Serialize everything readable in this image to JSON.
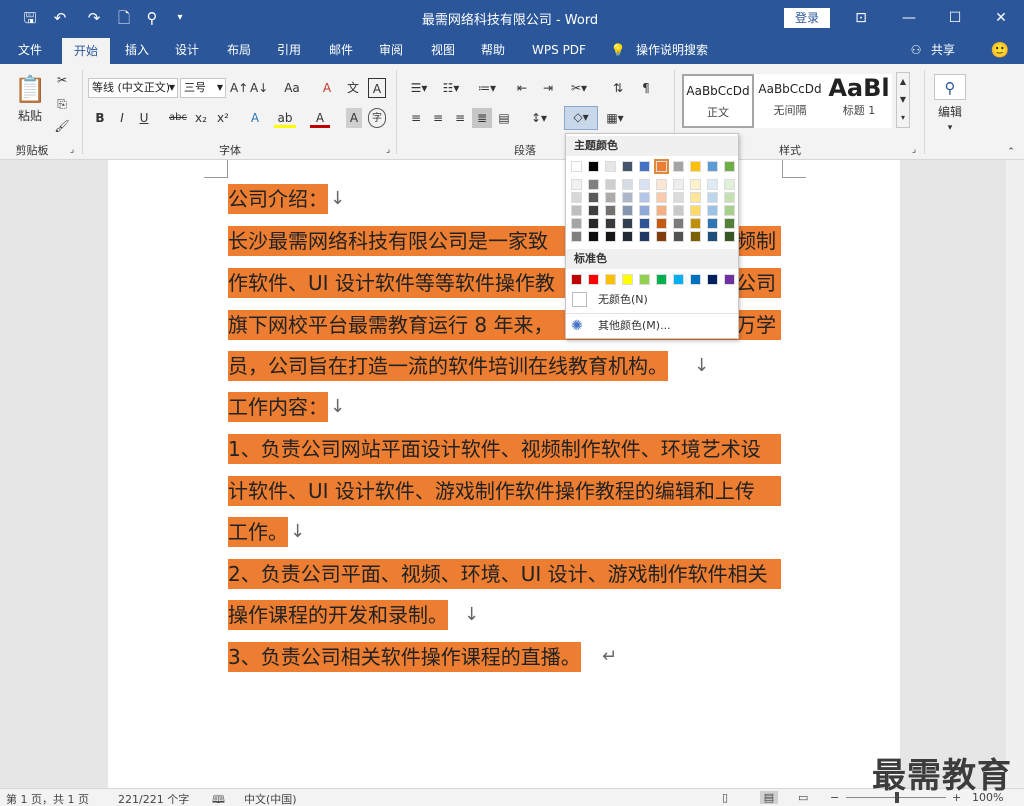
{
  "titlebar": {
    "title": "最需网络科技有限公司  -  Word",
    "login": "登录",
    "ribbon_display": "⊡",
    "minimize": "—",
    "maximize": "☐",
    "close": "✕"
  },
  "quick_access": {
    "save": "🖫",
    "undo": "↶",
    "redo": "↷",
    "new": "🗋",
    "touch": "⚲",
    "more": "▾"
  },
  "tabs": [
    "文件",
    "开始",
    "插入",
    "设计",
    "布局",
    "引用",
    "邮件",
    "审阅",
    "视图",
    "帮助",
    "WPS PDF"
  ],
  "tell_me": "操作说明搜索",
  "share": "共享",
  "feedback": "🙂",
  "ribbon": {
    "clipboard": {
      "paste": "粘贴",
      "group": "剪贴板"
    },
    "font": {
      "face": "等线 (中文正文)",
      "size": "三号",
      "bold": "B",
      "italic": "I",
      "underline": "U",
      "strike": "abc",
      "sub": "x₂",
      "sup": "x²",
      "grow": "A↑",
      "shrink": "A↓",
      "case": "Aa",
      "clear": "A",
      "phon": "文",
      "border": "A",
      "text_effect": "A",
      "highlight": "ab",
      "font_color": "A",
      "shading": "A",
      "enclose": "字",
      "group": "字体"
    },
    "paragraph": {
      "group": "段落"
    },
    "styles": {
      "items": [
        {
          "sample": "AaBbCcDd",
          "name": "正文"
        },
        {
          "sample": "AaBbCcDd",
          "name": "无间隔"
        },
        {
          "sample": "AaBl",
          "name": "标题 1"
        }
      ],
      "group": "样式"
    },
    "editing": {
      "label": "编辑"
    }
  },
  "doc": {
    "lines": [
      {
        "text": "公司介绍：",
        "mark": "↓"
      },
      {
        "text": "长沙最需网络科技有限公司是一家致",
        "tail": "频制"
      },
      {
        "text": "作软件、UI 设计软件等等软件操作教",
        "tail": "公司"
      },
      {
        "text": "旗下网校平台最需教育运行 8 年来，",
        "tail": "万学"
      },
      {
        "text": "员，公司旨在打造一流的软件培训在线教育机构。",
        "mark": "↓"
      },
      {
        "text": "工作内容：",
        "mark": "↓"
      },
      {
        "text": "1、负责公司网站平面设计软件、视频制作软件、环境艺术设"
      },
      {
        "text": "计软件、UI 设计软件、游戏制作软件操作教程的编辑和上传"
      },
      {
        "text": "工作。",
        "mark": "↓"
      },
      {
        "text": "2、负责公司平面、视频、环境、UI 设计、游戏制作软件相关"
      },
      {
        "text": "操作课程的开发和录制。",
        "mark": "↓"
      },
      {
        "text": "3、负责公司相关软件操作课程的直播。",
        "mark": "↵"
      }
    ]
  },
  "color_panel": {
    "theme_header": "主题颜色",
    "standard_header": "标准色",
    "no_color": "无颜色(N)",
    "more_colors": "其他颜色(M)...",
    "theme_top": [
      "#ffffff",
      "#000000",
      "#e7e6e6",
      "#44546a",
      "#4472c4",
      "#ed7d31",
      "#a5a5a5",
      "#ffc000",
      "#5b9bd5",
      "#70ad47"
    ],
    "theme_tints": [
      [
        "#f2f2f2",
        "#808080",
        "#d0cece",
        "#d6dce4",
        "#d9e2f3",
        "#fbe5d5",
        "#ededed",
        "#fff2cc",
        "#deebf6",
        "#e2efd9"
      ],
      [
        "#d8d8d8",
        "#595959",
        "#aeaaaa",
        "#adb9ca",
        "#b4c6e7",
        "#f7cbac",
        "#dbdbdb",
        "#fee599",
        "#bdd7ee",
        "#c5e0b3"
      ],
      [
        "#bfbfbf",
        "#3f3f3f",
        "#757070",
        "#8496b0",
        "#8eaadb",
        "#f4b183",
        "#c9c9c9",
        "#ffd965",
        "#9cc3e5",
        "#a8d08d"
      ],
      [
        "#a5a5a5",
        "#262626",
        "#3a3838",
        "#323f4f",
        "#2f5496",
        "#c55a11",
        "#7b7b7b",
        "#bf9000",
        "#2e75b5",
        "#538135"
      ],
      [
        "#7f7f7f",
        "#0c0c0c",
        "#171616",
        "#222a35",
        "#1f3864",
        "#833c0b",
        "#525252",
        "#7f6000",
        "#1e4e79",
        "#375623"
      ]
    ],
    "standard": [
      "#c00000",
      "#ff0000",
      "#ffc000",
      "#ffff00",
      "#92d050",
      "#00b050",
      "#00b0f0",
      "#0070c0",
      "#002060",
      "#7030a0"
    ]
  },
  "status": {
    "page": "第 1 页，共 1 页",
    "words": "221/221 个字",
    "proof": "🕮",
    "lang": "中文(中国)",
    "zoom": "100%",
    "minus": "−",
    "plus": "+"
  },
  "watermark": "最需教育",
  "colors": {
    "accent": "#2b579a",
    "highlight": "#ed7d31"
  }
}
